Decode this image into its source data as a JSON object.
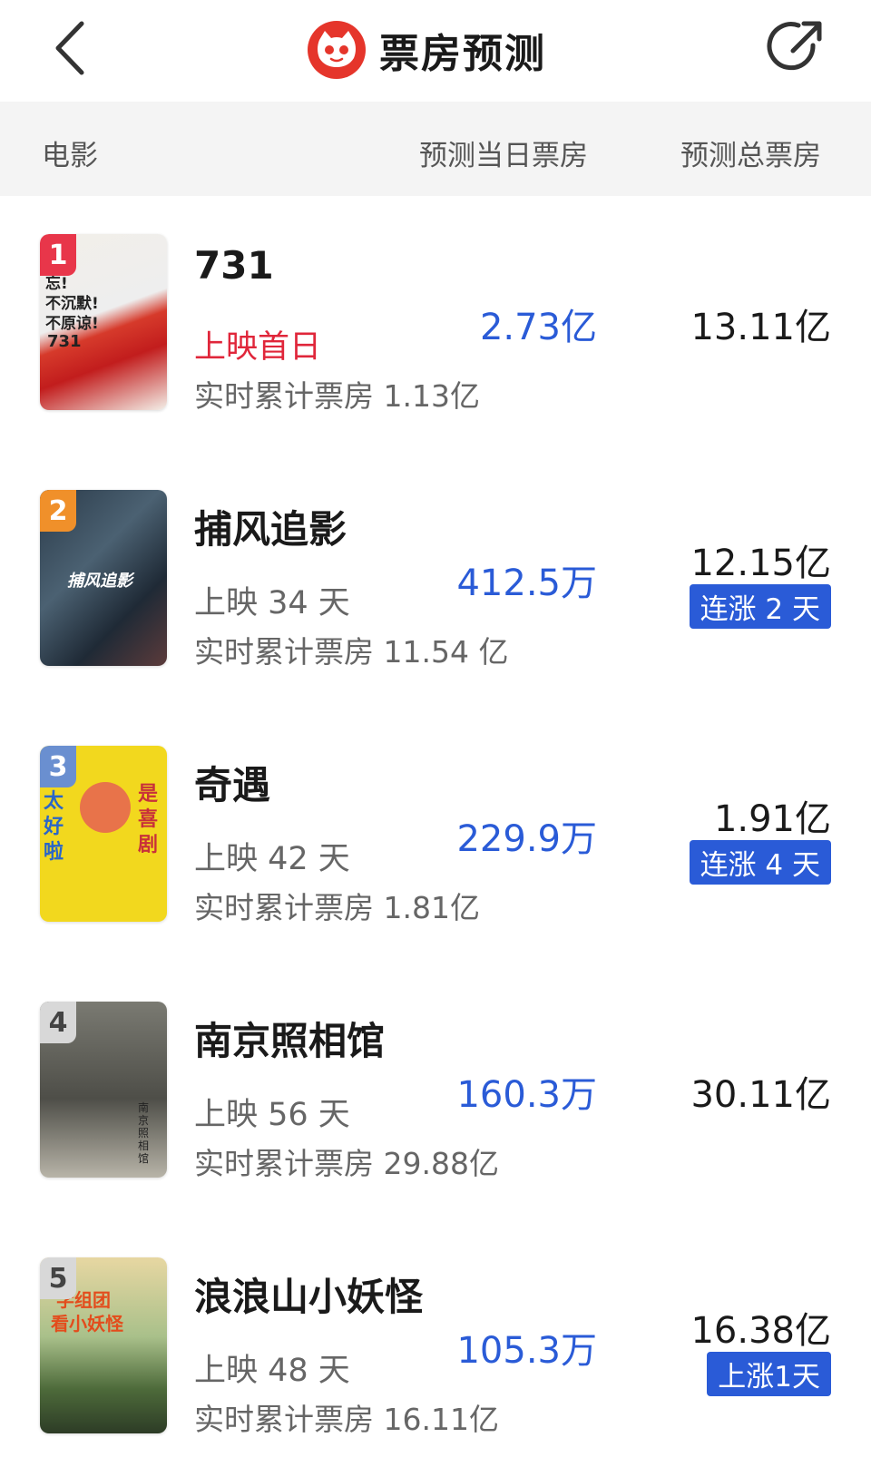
{
  "header": {
    "title": "票房预测"
  },
  "columns": {
    "movie": "电影",
    "daily": "预测当日票房",
    "total": "预测总票房"
  },
  "movies": [
    {
      "rank": "1",
      "name": "731",
      "release": "上映首日",
      "cumulative": "实时累计票房 1.13亿",
      "daily": "2.73亿",
      "total": "13.11亿",
      "badge": null,
      "poster_text": [
        "忘!",
        "不沉默!",
        "不原谅!",
        "731"
      ],
      "rank_color": "#e8364a"
    },
    {
      "rank": "2",
      "name": "捕风追影",
      "release": "上映 34 天",
      "cumulative": "实时累计票房 11.54 亿",
      "daily": "412.5万",
      "total": "12.15亿",
      "badge": "连涨 2 天",
      "poster_text": [
        "捕风追影"
      ],
      "rank_color": "#f0902a"
    },
    {
      "rank": "3",
      "name": "奇遇",
      "release": "上映 42 天",
      "cumulative": "实时累计票房 1.81亿",
      "daily": "229.9万",
      "total": "1.91亿",
      "badge": "连涨 4 天",
      "poster_text": [
        "太好啦",
        "是喜剧"
      ],
      "rank_color": "#6a8fd0"
    },
    {
      "rank": "4",
      "name": "南京照相馆",
      "release": "上映 56 天",
      "cumulative": "实时累计票房 29.88亿",
      "daily": "160.3万",
      "total": "30.11亿",
      "badge": null,
      "poster_text": [
        "南京照相馆"
      ],
      "rank_color": "#d8d8d8"
    },
    {
      "rank": "5",
      "name": "浪浪山小妖怪",
      "release": "上映 48 天",
      "cumulative": "实时累计票房 16.11亿",
      "daily": "105.3万",
      "total": "16.38亿",
      "badge": "上涨1天",
      "poster_text": [
        "学组团",
        "看小妖怪"
      ],
      "rank_color": "#d8d8d8"
    }
  ],
  "colors": {
    "accent_blue": "#2a5bd7",
    "first_day_red": "#e0263a",
    "logo_red": "#e5352b"
  }
}
